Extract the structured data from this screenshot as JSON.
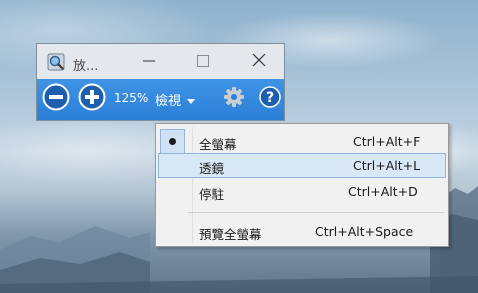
{
  "window": {
    "title": "放...",
    "app_icon": "magnifier-icon",
    "controls": {
      "minimize": "minimize-icon",
      "maximize": "maximize-icon",
      "close": "close-icon"
    }
  },
  "toolbar": {
    "zoom_out_icon": "zoom-out-icon",
    "zoom_in_icon": "zoom-in-icon",
    "zoom_level": "125%",
    "views_label": "檢視",
    "views_icon": "chevron-down-icon",
    "settings_icon": "gear-icon",
    "help_icon": "help-icon",
    "accent": "#2b7fd6"
  },
  "menu": {
    "items": [
      {
        "label": "全螢幕",
        "shortcut": "Ctrl+Alt+F",
        "selected": true
      },
      {
        "label": "透鏡",
        "shortcut": "Ctrl+Alt+L",
        "highlighted": true
      },
      {
        "label": "停駐",
        "shortcut": "Ctrl+Alt+D"
      },
      {
        "label": "預覽全螢幕",
        "shortcut": "Ctrl+Alt+Space"
      }
    ],
    "highlight_color": "#d9e8f6"
  }
}
